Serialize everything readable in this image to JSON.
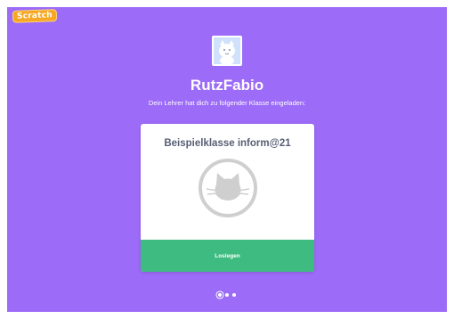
{
  "app": {
    "logo_text": "Scratch"
  },
  "invite": {
    "username": "RutzFabio",
    "message": "Dein Lehrer hat dich zu folgender Klasse eingeladen:"
  },
  "class_card": {
    "class_name": "Beispielklasse inform@21",
    "image_icon": "cat-icon",
    "button_label": "Loslegen"
  },
  "pagination": {
    "total_steps": 3,
    "current_step": 1
  },
  "colors": {
    "background": "#9c6bf7",
    "button": "#3ebb80",
    "title_text": "#575e75",
    "avatar_bg": "#cfe1fb"
  }
}
